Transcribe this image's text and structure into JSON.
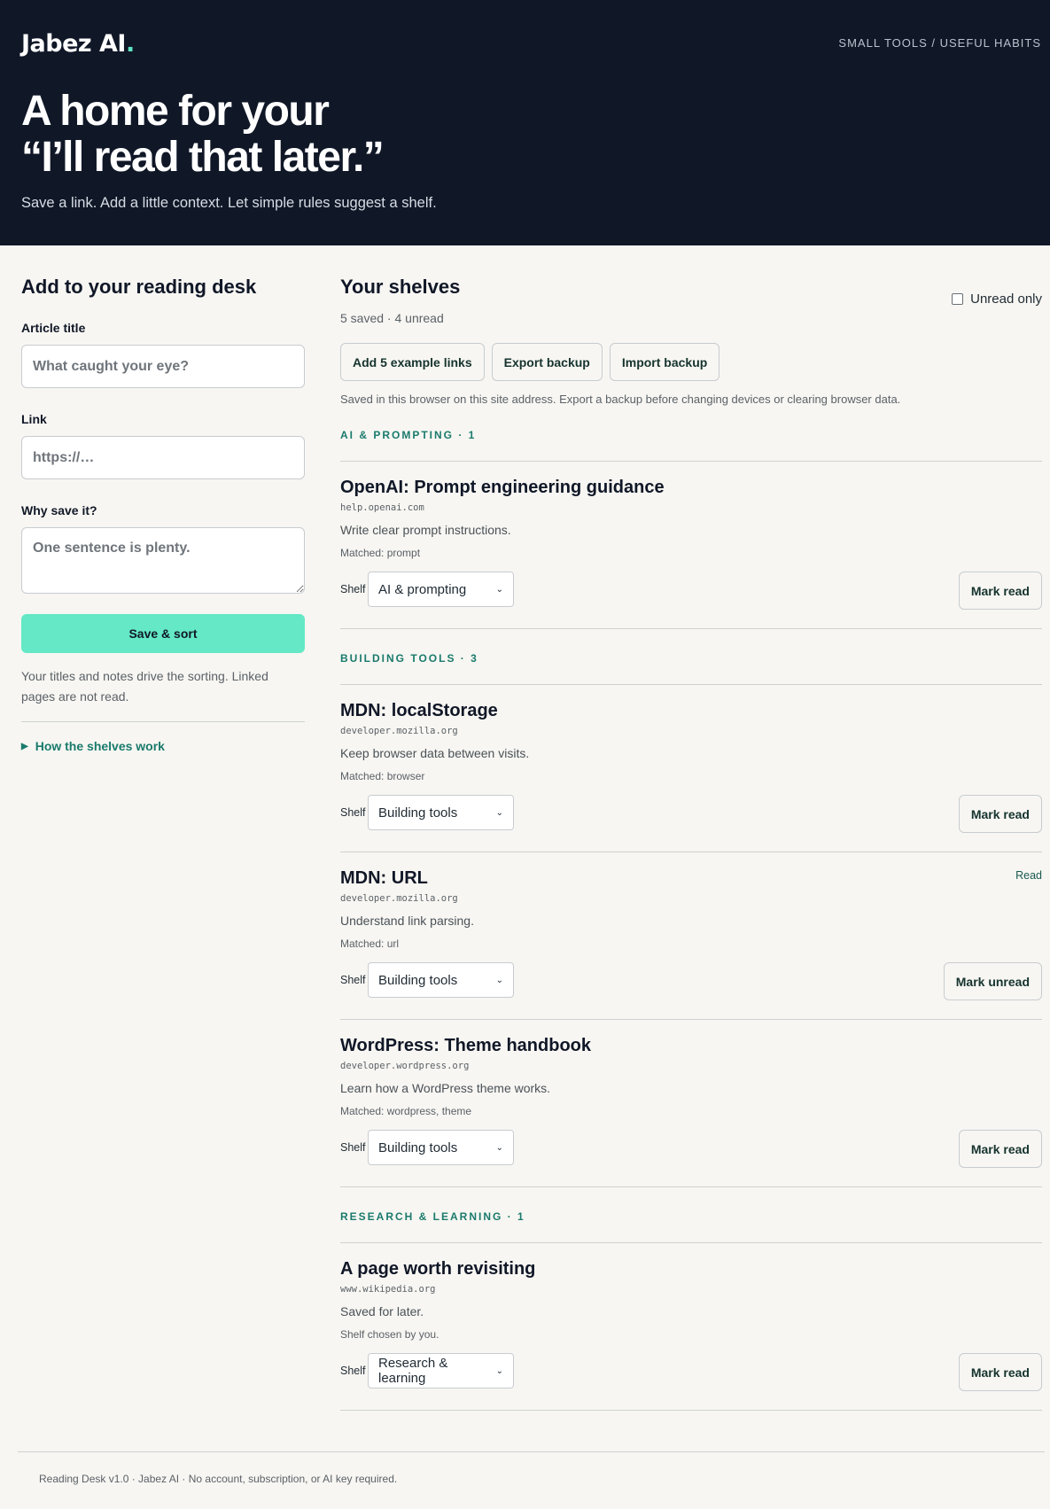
{
  "header": {
    "logo": "Jabez AI",
    "logo_dot": ".",
    "tagline": "SMALL TOOLS / USEFUL HABITS",
    "title_line1": "A home for your",
    "title_line2": "“I’ll read that later.”",
    "subtitle": "Save a link. Add a little context. Let simple rules suggest a shelf."
  },
  "form": {
    "heading": "Add to your reading desk",
    "title_label": "Article title",
    "title_placeholder": "What caught your eye?",
    "link_label": "Link",
    "link_placeholder": "https://…",
    "why_label": "Why save it?",
    "why_placeholder": "One sentence is plenty.",
    "save_button": "Save & sort",
    "help_text": "Your titles and notes drive the sorting. Linked pages are not read.",
    "details_label": "How the shelves work"
  },
  "shelves_panel": {
    "heading": "Your shelves",
    "counts": "5 saved · 4 unread",
    "unread_only_label": "Unread only",
    "buttons": {
      "add_examples": "Add 5 example links",
      "export": "Export backup",
      "import": "Import backup"
    },
    "storage_note": "Saved in this browser on this site address. Export a backup before changing devices or clearing browser data.",
    "shelf_label": "Shelf"
  },
  "shelves": [
    {
      "heading": "AI & PROMPTING · 1",
      "items": [
        {
          "title": "OpenAI: Prompt engineering guidance",
          "domain": "help.openai.com",
          "note": "Write clear prompt instructions.",
          "match": "Matched: prompt",
          "shelf": "AI & prompting",
          "action": "Mark read",
          "badge": ""
        }
      ]
    },
    {
      "heading": "BUILDING TOOLS · 3",
      "items": [
        {
          "title": "MDN: localStorage",
          "domain": "developer.mozilla.org",
          "note": "Keep browser data between visits.",
          "match": "Matched: browser",
          "shelf": "Building tools",
          "action": "Mark read",
          "badge": ""
        },
        {
          "title": "MDN: URL",
          "domain": "developer.mozilla.org",
          "note": "Understand link parsing.",
          "match": "Matched: url",
          "shelf": "Building tools",
          "action": "Mark unread",
          "badge": "Read"
        },
        {
          "title": "WordPress: Theme handbook",
          "domain": "developer.wordpress.org",
          "note": "Learn how a WordPress theme works.",
          "match": "Matched: wordpress, theme",
          "shelf": "Building tools",
          "action": "Mark read",
          "badge": ""
        }
      ]
    },
    {
      "heading": "RESEARCH & LEARNING · 1",
      "items": [
        {
          "title": "A page worth revisiting",
          "domain": "www.wikipedia.org",
          "note": "Saved for later.",
          "match": "Shelf chosen by you.",
          "shelf": "Research & learning",
          "action": "Mark read",
          "badge": ""
        }
      ]
    }
  ],
  "footer": {
    "text": "Reading Desk v1.0 · Jabez AI · No account, subscription, or AI key required."
  },
  "colors": {
    "header_bg": "#101727",
    "accent": "#64e8c5",
    "teal_text": "#1a7a6c",
    "page_bg": "#f7f6f2"
  }
}
